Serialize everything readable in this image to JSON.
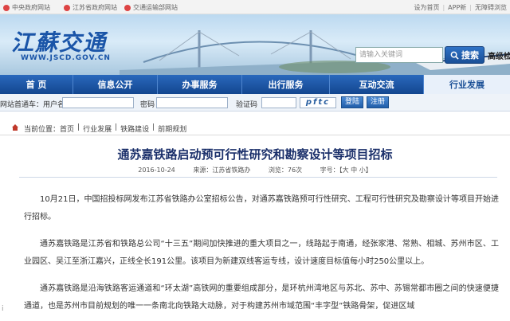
{
  "topbar": {
    "links": [
      "中央政府网站",
      "江苏省政府网站",
      "交通运输部网站"
    ],
    "right": [
      "设为首页",
      "APP新",
      "无障碍浏览"
    ]
  },
  "banner": {
    "logo_text": "江蘇交通",
    "logo_url": "WWW.JSCD.GOV.CN",
    "search_placeholder": "请输入关键词",
    "search_label": "搜索",
    "advanced_label": "高级检"
  },
  "nav": {
    "items": [
      "首 页",
      "信息公开",
      "办事服务",
      "出行服务",
      "互动交流",
      "行业发展"
    ],
    "active_index": 5
  },
  "login": {
    "platform_label": "网站首通车：用户名",
    "password_label": "密码",
    "verify_label": "验证码",
    "captcha": "pftc",
    "login_button": "登陆",
    "reset_button": "注册"
  },
  "breadcrumb": {
    "items": [
      "当前位置：首页",
      "行业发展",
      "铁路建设",
      "前期规划"
    ],
    "separator": "|"
  },
  "article": {
    "title": "通苏嘉铁路启动预可行性研究和勘察设计等项目招标",
    "date": "2016-10-24",
    "source": "来源：江苏省铁路办",
    "views": "浏览：76次",
    "font_size": "字号：【大 中 小】",
    "paragraphs": [
      "10月21日，中国招投标网发布江苏省铁路办公室招标公告，对通苏嘉铁路预可行性研究、工程可行性研究及勘察设计等项目开始进行招标。",
      "通苏嘉铁路是江苏省和铁路总公司“十三五”期间加快推进的重大项目之一，线路起于南通，经张家港、常熟、相城、苏州市区、工业园区、吴江至浙江嘉兴，正线全长191公里。该项目为新建双线客运专线，设计速度目标值每小时250公里以上。",
      "通苏嘉铁路是沿海铁路客运通道和“环太湖”高铁网的重要组成部分，是环杭州湾地区与苏北、苏中、苏锡常都市圈之间的快速便捷通道，也是苏州市目前规划的唯一一条南北向铁路大动脉，对于构建苏州市域范围“丰字型”铁路骨架，促进区域"
    ]
  },
  "watermark": "i"
}
